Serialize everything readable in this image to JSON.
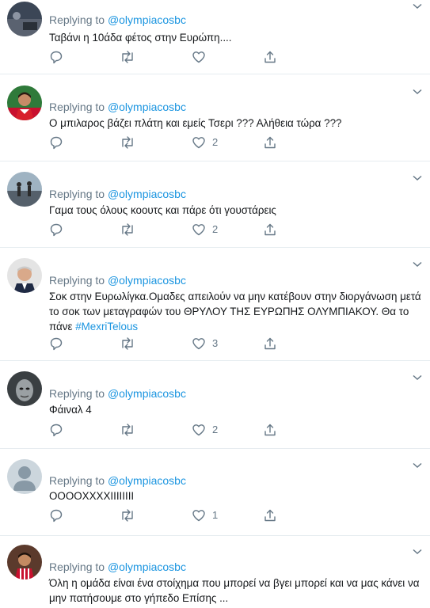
{
  "reply_prefix": "Replying to",
  "tweets": [
    {
      "handle": "@olympiacosbc",
      "text": "Ταβάνι η 10άδα φέτος στην Ευρώπη....",
      "likes": ""
    },
    {
      "handle": "@olympiacosbc",
      "text": "Ο μπιλαρος βάζει πλάτη και εμείς Τσερι ??? Αλήθεια τώρα ???",
      "likes": "2"
    },
    {
      "handle": "@olympiacosbc",
      "text": "Γαμα τους όλους κοουτς και πάρε ότι γουστάρεις",
      "likes": "2"
    },
    {
      "handle": "@olympiacosbc",
      "text": "Σοκ στην Ευρωλίγκα.Ομαδες απειλούν να μην κατέβουν στην διοργάνωση μετά το σοκ των μεταγραφών του ΘΡΥΛΟΥ ΤΗΣ ΕΥΡΩΠΗΣ ΟΛΥΜΠΙΑΚΟΥ. Θα το πάνε",
      "hashtag": "#MexriTelous",
      "likes": "3"
    },
    {
      "handle": "@olympiacosbc",
      "text": "Φάιναλ 4",
      "likes": "2"
    },
    {
      "handle": "@olympiacosbc",
      "text": "ΟΟΟΟΧΧΧΧΙΙΙΙΙΙΙΙ",
      "likes": "1"
    },
    {
      "handle": "@olympiacosbc",
      "text": "Όλη η ομάδα είναι ένα στοίχημα που μπορεί να βγει μπορεί και να μας κάνει να μην πατήσουμε στο γήπεδο Επίσης ...",
      "likes": ""
    }
  ],
  "colors": {
    "link": "#1b95e0",
    "muted": "#657786",
    "divider": "#e6ecf0"
  }
}
